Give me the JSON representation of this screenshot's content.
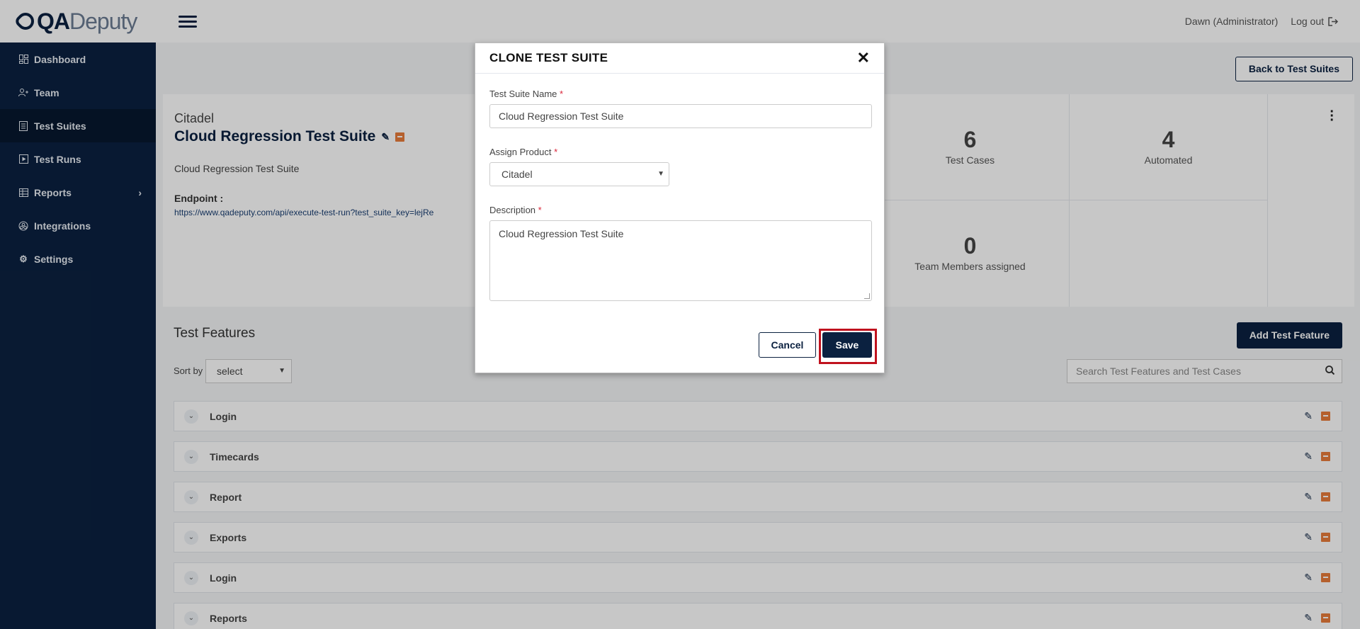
{
  "brand": {
    "qa": "QA",
    "deputy": "Deputy"
  },
  "sidebar": {
    "items": [
      {
        "label": "Dashboard",
        "icon": "dashboard-icon"
      },
      {
        "label": "Team",
        "icon": "team-icon"
      },
      {
        "label": "Test Suites",
        "icon": "test-suites-icon",
        "active": true
      },
      {
        "label": "Test Runs",
        "icon": "test-runs-icon"
      },
      {
        "label": "Reports",
        "icon": "reports-icon",
        "has_submenu": true
      },
      {
        "label": "Integrations",
        "icon": "integrations-icon"
      },
      {
        "label": "Settings",
        "icon": "settings-icon"
      }
    ]
  },
  "header": {
    "user": "Dawn (Administrator)",
    "logout_label": "Log out"
  },
  "page": {
    "back_label": "Back to Test Suites",
    "product": "Citadel",
    "suite_title": "Cloud Regression Test Suite",
    "suite_description": "Cloud Regression Test Suite",
    "endpoint_label": "Endpoint :",
    "endpoint_url": "https://www.qadeputy.com/api/execute-test-run?test_suite_key=lejRe",
    "stats": [
      {
        "value": "6",
        "label": "Test Cases"
      },
      {
        "value": "4",
        "label": "Automated"
      },
      {
        "value": "0",
        "label": "Team Members assigned"
      }
    ],
    "features_title": "Test Features",
    "add_feature_label": "Add Test Feature",
    "sort_label": "Sort by",
    "sort_value": "select",
    "search_placeholder": "Search Test Features and Test Cases",
    "features": [
      "Login",
      "Timecards",
      "Report",
      "Exports",
      "Login",
      "Reports"
    ]
  },
  "modal": {
    "title": "CLONE TEST SUITE",
    "name_label": "Test Suite Name",
    "name_value": "Cloud Regression Test Suite",
    "product_label": "Assign Product",
    "product_value": "Citadel",
    "description_label": "Description",
    "description_value": "Cloud Regression Test Suite",
    "required_mark": "*",
    "cancel_label": "Cancel",
    "save_label": "Save"
  },
  "colors": {
    "navy": "#0b2140",
    "accent_orange": "#e87b3a",
    "required_red": "#d9263a",
    "highlight_red": "#c0121e"
  }
}
